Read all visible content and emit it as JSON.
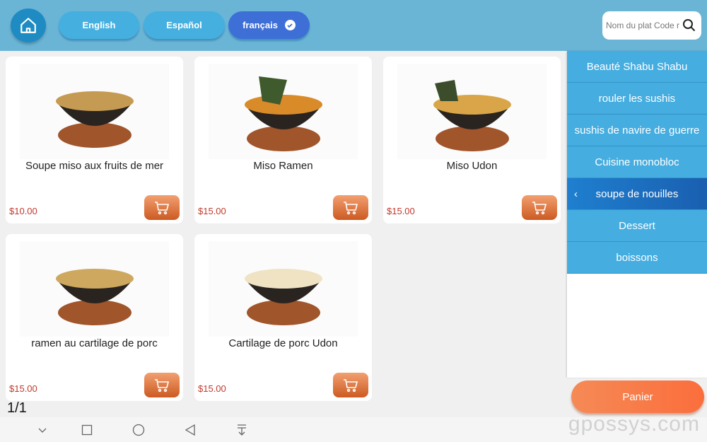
{
  "header": {
    "home_icon": "home-icon",
    "languages": [
      {
        "label": "English",
        "active": false
      },
      {
        "label": "Español",
        "active": false
      },
      {
        "label": "français",
        "active": true
      }
    ],
    "search": {
      "placeholder": "Nom du plat Code r",
      "icon": "search-icon"
    }
  },
  "products": [
    {
      "name": "Soupe miso aux fruits de mer",
      "price": "$10.00"
    },
    {
      "name": "Miso Ramen",
      "price": "$15.00"
    },
    {
      "name": "Miso Udon",
      "price": "$15.00"
    },
    {
      "name": "ramen au cartilage de porc",
      "price": "$15.00"
    },
    {
      "name": "Cartilage de porc Udon",
      "price": "$15.00"
    }
  ],
  "categories": [
    {
      "label": "Beauté Shabu Shabu",
      "active": false
    },
    {
      "label": "rouler les sushis",
      "active": false
    },
    {
      "label": "sushis de navire de guerre",
      "active": false
    },
    {
      "label": "Cuisine monobloc",
      "active": false
    },
    {
      "label": "soupe de nouilles",
      "active": true
    },
    {
      "label": "Dessert",
      "active": false
    },
    {
      "label": "boissons",
      "active": false
    }
  ],
  "cart_button": "Panier",
  "pager": "1/1",
  "watermark": "gpossys.com",
  "colors": {
    "topbar": "#6ab4d6",
    "accent": "#3d6fd6",
    "price": "#c0392b",
    "cart": "#fb6e3c"
  }
}
